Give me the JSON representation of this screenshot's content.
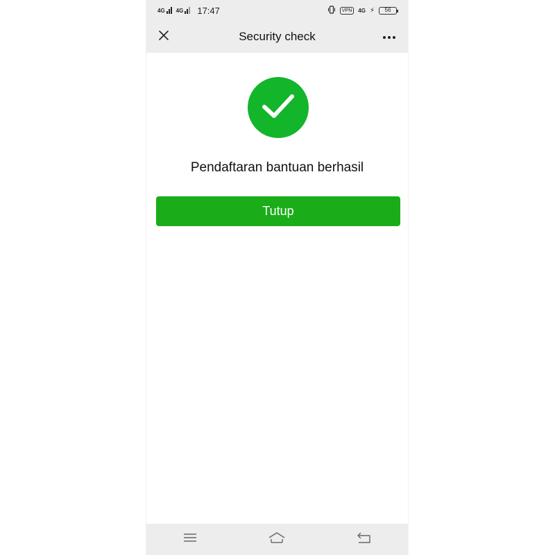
{
  "status_bar": {
    "network_left_1": "4G",
    "network_left_2": "4G",
    "time": "17:47",
    "vpn_label": "VPN",
    "network_right": "4G",
    "battery_level": "56"
  },
  "header": {
    "title": "Security check"
  },
  "main": {
    "message": "Pendaftaran bantuan berhasil",
    "close_button_label": "Tutup"
  },
  "icons": {
    "close": "close-icon",
    "more": "more-dots-icon",
    "success": "checkmark-icon",
    "menu": "menu-icon",
    "home": "home-icon",
    "back": "back-icon"
  },
  "colors": {
    "accent": "#1aad19",
    "success_circle": "#13b52b",
    "bar_background": "#ededed"
  }
}
